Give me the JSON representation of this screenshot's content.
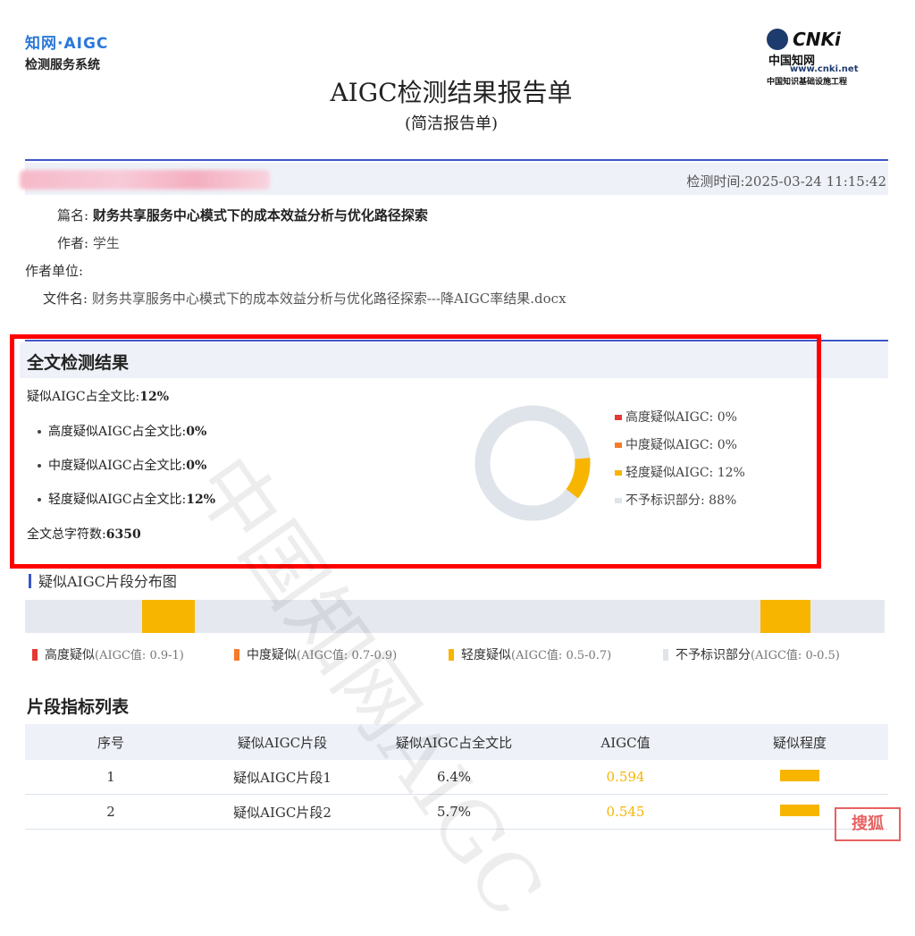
{
  "brand": {
    "logo_text": "知网·AIGC",
    "system_name": "检测服务系统",
    "cnki_mark": "CNKi",
    "cnki_cn": "中国知网",
    "cnki_url": "www.cnki.net",
    "cnki_tag": "中国知识基础设施工程"
  },
  "report": {
    "title": "AIGC检测结果报告单",
    "subtitle": "(简洁报告单)",
    "check_time": "检测时间:2025-03-24 11:15:42"
  },
  "meta": {
    "title_label": "篇名:",
    "title_value": "财务共享服务中心模式下的成本效益分析与优化路径探索",
    "author_label": "作者:",
    "author_value": "学生",
    "unit_label": "作者单位:",
    "unit_value": "",
    "file_label": "文件名:",
    "file_value": "财务共享服务中心模式下的成本效益分析与优化路径探索---降AIGC率结果.docx"
  },
  "result": {
    "section_title": "全文检测结果",
    "overall_label": "疑似AIGC占全文比:",
    "overall_value": "12%",
    "high_label": "高度疑似AIGC占全文比:",
    "high_value": "0%",
    "medium_label": "中度疑似AIGC占全文比:",
    "medium_value": "0%",
    "light_label": "轻度疑似AIGC占全文比:",
    "light_value": "12%",
    "chars_label": "全文总字符数:",
    "chars_value": "6350",
    "legend": [
      {
        "label": "高度疑似AIGC: 0%",
        "color": "#e53935"
      },
      {
        "label": "中度疑似AIGC: 0%",
        "color": "#f57c2a"
      },
      {
        "label": "轻度疑似AIGC: 12%",
        "color": "#f7b500"
      },
      {
        "label": "不予标识部分: 88%",
        "color": "#dfe3ea"
      }
    ]
  },
  "chart_data": {
    "type": "pie",
    "categories": [
      "高度疑似AIGC",
      "中度疑似AIGC",
      "轻度疑似AIGC",
      "不予标识部分"
    ],
    "values": [
      0,
      0,
      12,
      88
    ],
    "colors": [
      "#e53935",
      "#f57c2a",
      "#f7b500",
      "#dfe3ea"
    ],
    "title": "",
    "legend": "right"
  },
  "distribution": {
    "title": "疑似AIGC片段分布图",
    "segments": [
      {
        "start": 0.136,
        "end": 0.198
      },
      {
        "start": 0.856,
        "end": 0.914
      }
    ],
    "legend": [
      {
        "name": "高度疑似",
        "range": "(AIGC值: 0.9-1)",
        "color": "#e53935"
      },
      {
        "name": "中度疑似",
        "range": "(AIGC值: 0.7-0.9)",
        "color": "#f57c2a"
      },
      {
        "name": "轻度疑似",
        "range": "(AIGC值: 0.5-0.7)",
        "color": "#f7b500"
      },
      {
        "name": "不予标识部分",
        "range": "(AIGC值: 0-0.5)",
        "color": "#dfe3ea"
      }
    ]
  },
  "table": {
    "title": "片段指标列表",
    "headers": [
      "序号",
      "疑似AIGC片段",
      "疑似AIGC占全文比",
      "AIGC值",
      "疑似程度"
    ],
    "rows": [
      {
        "no": "1",
        "name": "疑似AIGC片段1",
        "ratio": "6.4%",
        "aigc": "0.594"
      },
      {
        "no": "2",
        "name": "疑似AIGC片段2",
        "ratio": "5.7%",
        "aigc": "0.545"
      }
    ]
  },
  "watermark": "中国知网AIGC",
  "stamp_text": "搜狐"
}
